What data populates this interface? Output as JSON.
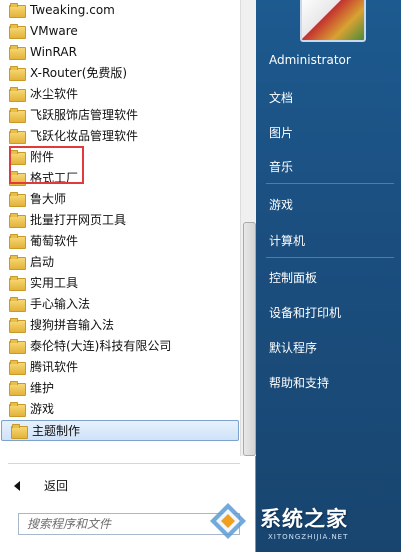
{
  "programs": [
    {
      "label": "Tweaking.com"
    },
    {
      "label": "VMware"
    },
    {
      "label": "WinRAR"
    },
    {
      "label": "X-Router(免费版)"
    },
    {
      "label": "冰尘软件"
    },
    {
      "label": "飞跃服饰店管理软件"
    },
    {
      "label": "飞跃化妆品管理软件"
    },
    {
      "label": "附件"
    },
    {
      "label": "格式工厂"
    },
    {
      "label": "鲁大师"
    },
    {
      "label": "批量打开网页工具"
    },
    {
      "label": "葡萄软件"
    },
    {
      "label": "启动"
    },
    {
      "label": "实用工具"
    },
    {
      "label": "手心输入法"
    },
    {
      "label": "搜狗拼音输入法"
    },
    {
      "label": "泰伦特(大连)科技有限公司"
    },
    {
      "label": "腾讯软件"
    },
    {
      "label": "维护"
    },
    {
      "label": "游戏"
    },
    {
      "label": "主题制作"
    }
  ],
  "selected_index": 20,
  "highlighted_item": "附件",
  "back_label": "返回",
  "search_placeholder": "搜索程序和文件",
  "right_menu": {
    "user": "Administrator",
    "items": [
      "文档",
      "图片",
      "音乐",
      "游戏",
      "计算机",
      "控制面板",
      "设备和打印机",
      "默认程序",
      "帮助和支持"
    ]
  },
  "watermark": {
    "text": "系统之家",
    "sub": "XITONGZHIJIA.NET"
  },
  "colors": {
    "highlight_box": "#e03a3a",
    "right_panel": "#1b4f80",
    "selected_bg": "#cfe3f8"
  }
}
